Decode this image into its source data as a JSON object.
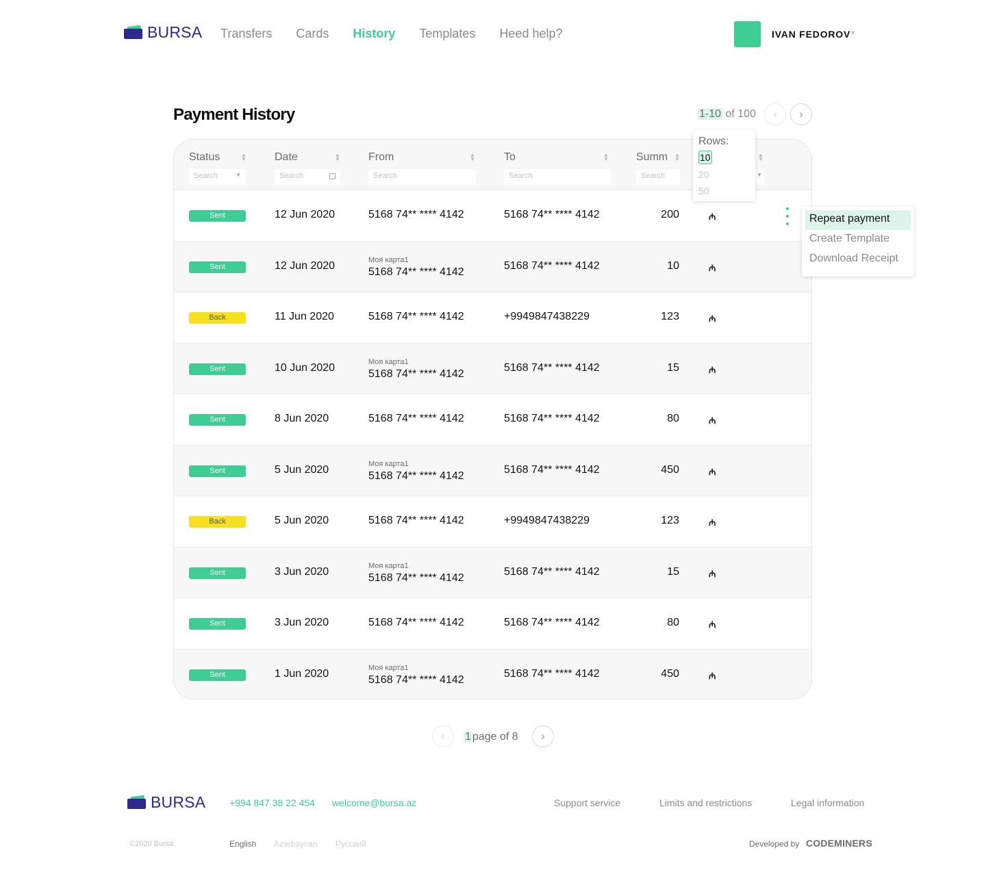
{
  "brand": {
    "name": "BURSA"
  },
  "nav": [
    {
      "label": "Transfers",
      "active": false
    },
    {
      "label": "Cards",
      "active": false
    },
    {
      "label": "History",
      "active": true
    },
    {
      "label": "Templates",
      "active": false
    },
    {
      "label": "Heed help?",
      "active": false
    }
  ],
  "user": {
    "name": "IVAN FEDOROV"
  },
  "page": {
    "title": "Payment History"
  },
  "pager_top": {
    "range": "1-10",
    "of_text": "of 100"
  },
  "table": {
    "columns": [
      {
        "label": "Status",
        "placeholder": "Search",
        "filter": "select"
      },
      {
        "label": "Date",
        "placeholder": "Search",
        "filter": "date"
      },
      {
        "label": "From",
        "placeholder": "Search",
        "filter": "text"
      },
      {
        "label": "To",
        "placeholder": "Search",
        "filter": "text"
      },
      {
        "label": "Summ",
        "placeholder": "Search",
        "filter": "text"
      }
    ],
    "rows": [
      {
        "status": "Sent",
        "status_type": "sent",
        "date": "12 Jun 2020",
        "from_label": "",
        "from": "5168 74** **** 4142",
        "to": "5168 74** **** 4142",
        "sum": "200",
        "currency": "₼"
      },
      {
        "status": "Sent",
        "status_type": "sent",
        "date": "12 Jun 2020",
        "from_label": "Моя карта1",
        "from": "5168 74** **** 4142",
        "to": "5168 74** **** 4142",
        "sum": "10",
        "currency": "₼"
      },
      {
        "status": "Back",
        "status_type": "back",
        "date": "11 Jun 2020",
        "from_label": "",
        "from": "5168 74** **** 4142",
        "to": "+9949847438229",
        "sum": "123",
        "currency": "₼"
      },
      {
        "status": "Sent",
        "status_type": "sent",
        "date": "10 Jun 2020",
        "from_label": "Моя карта1",
        "from": "5168 74** **** 4142",
        "to": "5168 74** **** 4142",
        "sum": "15",
        "currency": "₼"
      },
      {
        "status": "Sent",
        "status_type": "sent",
        "date": "8 Jun 2020",
        "from_label": "",
        "from": "5168 74** **** 4142",
        "to": "5168 74** **** 4142",
        "sum": "80",
        "currency": "₼"
      },
      {
        "status": "Sent",
        "status_type": "sent",
        "date": "5 Jun 2020",
        "from_label": "Моя карта1",
        "from": "5168 74** **** 4142",
        "to": "5168 74** **** 4142",
        "sum": "450",
        "currency": "₼"
      },
      {
        "status": "Back",
        "status_type": "back",
        "date": "5 Jun 2020",
        "from_label": "",
        "from": "5168 74** **** 4142",
        "to": "+9949847438229",
        "sum": "123",
        "currency": "₼"
      },
      {
        "status": "Sent",
        "status_type": "sent",
        "date": "3 Jun 2020",
        "from_label": "Моя карта1",
        "from": "5168 74** **** 4142",
        "to": "5168 74** **** 4142",
        "sum": "15",
        "currency": "₼"
      },
      {
        "status": "Sent",
        "status_type": "sent",
        "date": "3 Jun 2020",
        "from_label": "",
        "from": "5168 74** **** 4142",
        "to": "5168 74** **** 4142",
        "sum": "80",
        "currency": "₼"
      },
      {
        "status": "Sent",
        "status_type": "sent",
        "date": "1 Jun 2020",
        "from_label": "Моя карта1",
        "from": "5168 74** **** 4142",
        "to": "5168 74** **** 4142",
        "sum": "450",
        "currency": "₼"
      }
    ]
  },
  "rows_dropdown": {
    "label": "Rows:",
    "options": [
      "10",
      "20",
      "50"
    ],
    "selected": "10"
  },
  "actions_menu": {
    "items": [
      "Repeat payment",
      "Create Template",
      "Download Receipt"
    ],
    "highlighted": "Repeat payment"
  },
  "pager_bottom": {
    "page": "1",
    "of_text": "page of 8"
  },
  "footer": {
    "phone": "+994 847 38 22 454",
    "email": "welcome@bursa.az",
    "links": [
      "Support service",
      "Limits and restrictions",
      "Legal information"
    ],
    "copyright": "©2020 Bursa",
    "languages": [
      {
        "label": "English",
        "active": true
      },
      {
        "label": "Azərbaycan",
        "active": false
      },
      {
        "label": "Русский",
        "active": false
      }
    ],
    "developed_by": "Developed by",
    "developer": "CODEMINERS"
  },
  "colors": {
    "accent": "#3fcc95",
    "brand": "#2d2a8e",
    "back_badge": "#f6e022"
  },
  "icons": {
    "prev": "chevron-left-icon",
    "next": "chevron-right-icon",
    "menu": "kebab-icon",
    "calendar": "calendar-icon",
    "sort": "sort-icon",
    "currency": "manat-icon"
  }
}
